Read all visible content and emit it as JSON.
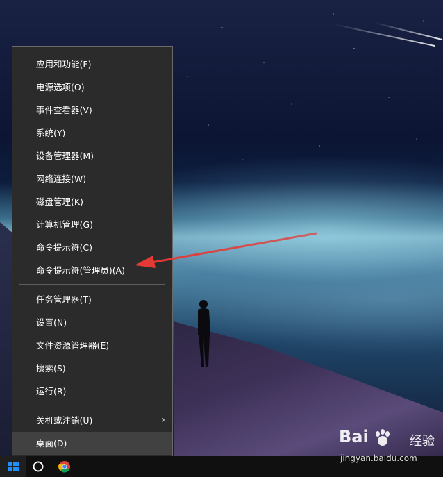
{
  "menu": {
    "items": [
      {
        "label": "应用和功能(F)"
      },
      {
        "label": "电源选项(O)"
      },
      {
        "label": "事件查看器(V)"
      },
      {
        "label": "系统(Y)"
      },
      {
        "label": "设备管理器(M)"
      },
      {
        "label": "网络连接(W)"
      },
      {
        "label": "磁盘管理(K)"
      },
      {
        "label": "计算机管理(G)"
      },
      {
        "label": "命令提示符(C)"
      },
      {
        "label": "命令提示符(管理员)(A)"
      },
      {
        "label": "任务管理器(T)"
      },
      {
        "label": "设置(N)"
      },
      {
        "label": "文件资源管理器(E)"
      },
      {
        "label": "搜索(S)"
      },
      {
        "label": "运行(R)"
      },
      {
        "label": "关机或注销(U)"
      },
      {
        "label": "桌面(D)"
      }
    ],
    "submenu_arrow": "›"
  },
  "annotation": {
    "arrow_color": "#e53935",
    "target": "命令提示符(管理员)(A)"
  },
  "taskbar": {
    "icons": [
      "windows-start-icon",
      "cortana-search-icon",
      "chrome-icon"
    ]
  },
  "watermark": {
    "logo_text": "Bai",
    "logo_suffix": "经验",
    "url": "jingyan.baidu.com"
  },
  "colors": {
    "menu_bg": "#2b2b2b",
    "menu_border": "#6a6a6a",
    "selected_bg": "#414141",
    "taskbar_bg": "#101010",
    "accent_blue": "#1e90ff"
  }
}
